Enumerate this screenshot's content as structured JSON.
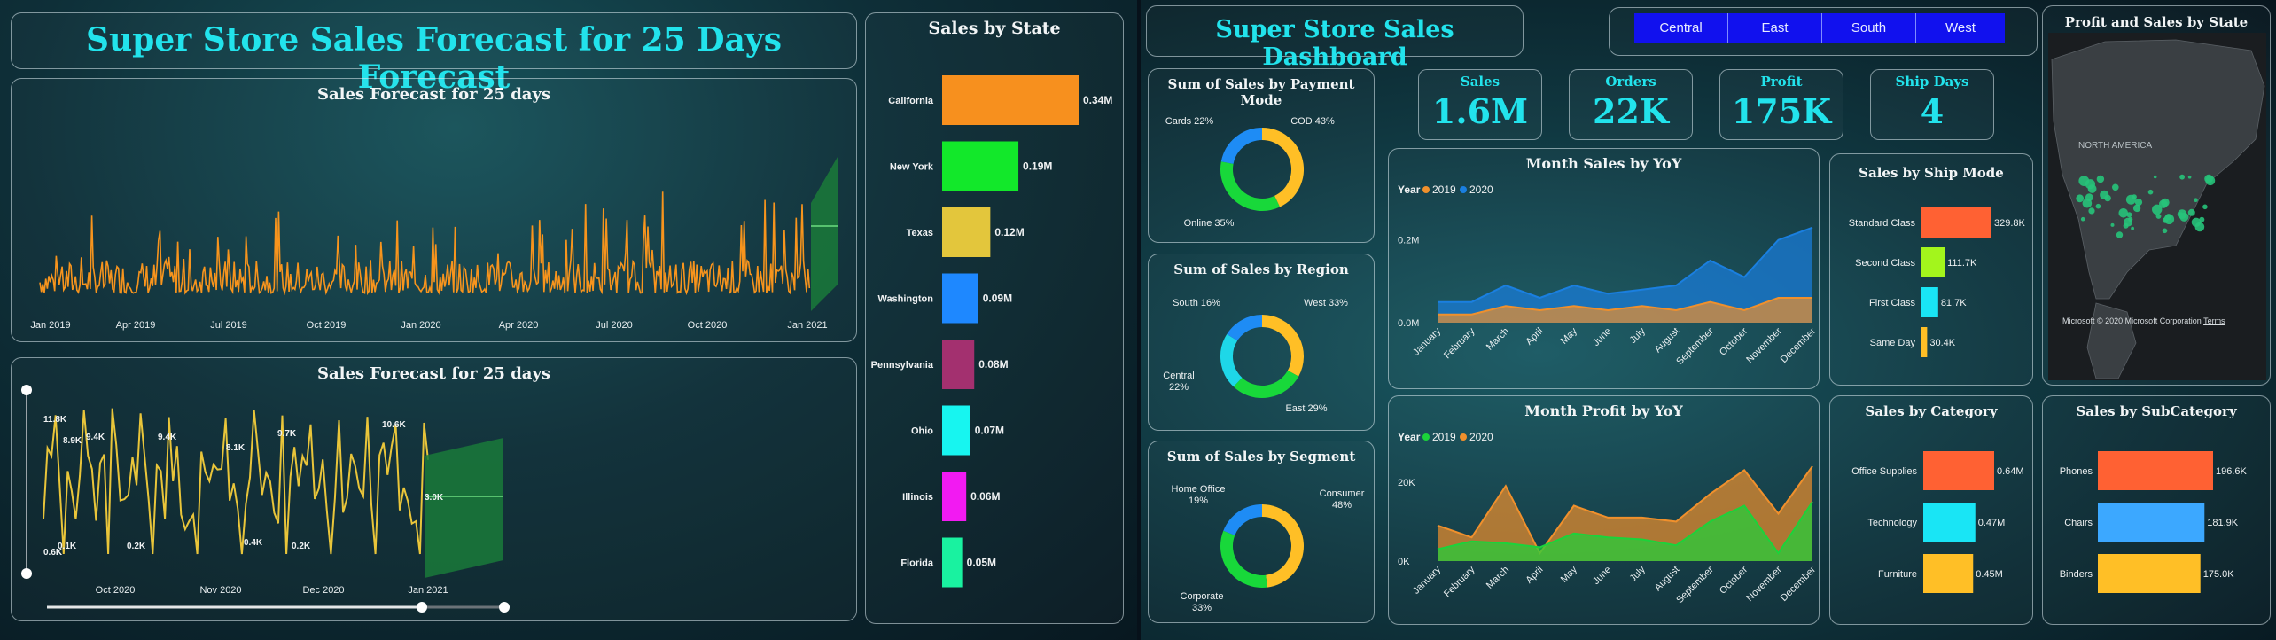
{
  "forecast": {
    "title": "Super Store Sales Forecast for 25 Days Forecast",
    "chart1": {
      "title": "Sales Forecast for 25 days",
      "x_ticks": [
        "Jan 2019",
        "Apr 2019",
        "Jul 2019",
        "Oct 2019",
        "Jan 2020",
        "Apr 2020",
        "Jul 2020",
        "Oct 2020",
        "Jan 2021"
      ]
    },
    "chart2": {
      "title": "Sales Forecast for 25 days",
      "x_ticks": [
        "Oct 2020",
        "Nov 2020",
        "Dec 2020",
        "Jan 2021"
      ],
      "peak_labels": [
        "11.8K",
        "8.9K",
        "9.4K",
        "9.4K",
        "8.1K",
        "9.7K",
        "10.6K",
        "3.0K"
      ],
      "low_labels": [
        "0.6K",
        "0.1K",
        "0.2K",
        "0.4K",
        "0.2K"
      ]
    },
    "state_chart": {
      "title": "Sales by State",
      "states": [
        "California",
        "New York",
        "Texas",
        "Washington",
        "Pennsylvania",
        "Ohio",
        "Illinois",
        "Florida"
      ],
      "values": [
        0.34,
        0.19,
        0.12,
        0.09,
        0.08,
        0.07,
        0.06,
        0.05
      ],
      "labels": [
        "0.34M",
        "0.19M",
        "0.12M",
        "0.09M",
        "0.08M",
        "0.07M",
        "0.06M",
        "0.05M"
      ],
      "colors": [
        "#f7901e",
        "#12e82a",
        "#e3c63c",
        "#1e88ff",
        "#a3306f",
        "#17f5f0",
        "#f21af2",
        "#19f2a0"
      ]
    }
  },
  "dashboard": {
    "title": "Super Store Sales Dashboard",
    "region_tabs": [
      "Central",
      "East",
      "South",
      "West"
    ],
    "kpis": [
      {
        "label": "Sales",
        "value": "1.6M"
      },
      {
        "label": "Orders",
        "value": "22K"
      },
      {
        "label": "Profit",
        "value": "175K"
      },
      {
        "label": "Ship Days",
        "value": "4"
      }
    ],
    "payment_chart": {
      "title": "Sum of Sales by Payment Mode",
      "slices": [
        {
          "name": "COD",
          "label": "COD 43%",
          "value": 43,
          "color": "#ffbf26"
        },
        {
          "name": "Online",
          "label": "Online 35%",
          "value": 35,
          "color": "#18d83a"
        },
        {
          "name": "Cards",
          "label": "Cards 22%",
          "value": 22,
          "color": "#1e8cf5"
        }
      ]
    },
    "region_chart": {
      "title": "Sum of Sales by Region",
      "slices": [
        {
          "name": "West",
          "label": "West 33%",
          "value": 33,
          "color": "#ffbf26"
        },
        {
          "name": "East",
          "label": "East 29%",
          "value": 29,
          "color": "#18d83a"
        },
        {
          "name": "Central",
          "label": "Central 22%",
          "value": 22,
          "color": "#1ed7e8"
        },
        {
          "name": "South",
          "label": "South 16%",
          "value": 16,
          "color": "#1e8cf5"
        }
      ]
    },
    "segment_chart": {
      "title": "Sum of Sales by Segment",
      "slices": [
        {
          "name": "Consumer",
          "label": "Consumer 48%",
          "value": 48,
          "color": "#ffbf26"
        },
        {
          "name": "Corporate",
          "label": "Corporate 33%",
          "value": 33,
          "color": "#18d83a"
        },
        {
          "name": "Home Office",
          "label": "Home Office 19%",
          "value": 19,
          "color": "#1e8cf5"
        }
      ]
    },
    "month_sales": {
      "title": "Month Sales by YoY",
      "legend_title": "Year",
      "months": [
        "January",
        "February",
        "March",
        "April",
        "May",
        "June",
        "July",
        "August",
        "September",
        "October",
        "November",
        "December"
      ],
      "y_ticks": [
        "0.0M",
        "0.2M"
      ],
      "series": [
        {
          "name": "2019",
          "color": "#f0902c",
          "values": [
            0.02,
            0.02,
            0.04,
            0.03,
            0.04,
            0.03,
            0.04,
            0.03,
            0.05,
            0.03,
            0.06,
            0.06
          ]
        },
        {
          "name": "2020",
          "color": "#1a7fe0",
          "values": [
            0.05,
            0.05,
            0.09,
            0.06,
            0.09,
            0.07,
            0.08,
            0.09,
            0.15,
            0.11,
            0.2,
            0.23
          ]
        }
      ]
    },
    "month_profit": {
      "title": "Month Profit by YoY",
      "legend_title": "Year",
      "months": [
        "January",
        "February",
        "March",
        "April",
        "May",
        "June",
        "July",
        "August",
        "September",
        "October",
        "November",
        "December"
      ],
      "y_ticks": [
        "0K",
        "20K"
      ],
      "series": [
        {
          "name": "2019",
          "color": "#1bd33a",
          "values": [
            3000,
            5000,
            4500,
            3500,
            7000,
            6000,
            5500,
            4000,
            10000,
            14000,
            2000,
            15000
          ]
        },
        {
          "name": "2020",
          "color": "#f0902c",
          "values": [
            9000,
            6000,
            19000,
            2000,
            14000,
            11000,
            11000,
            10000,
            17000,
            23000,
            12000,
            24000
          ]
        }
      ]
    },
    "ship_mode": {
      "title": "Sales by Ship Mode",
      "items": [
        "Standard Class",
        "Second Class",
        "First Class",
        "Same Day"
      ],
      "values": [
        329.8,
        111.7,
        81.7,
        30.4
      ],
      "labels": [
        "329.8K",
        "111.7K",
        "81.7K",
        "30.4K"
      ],
      "colors": [
        "#ff6133",
        "#a3f51c",
        "#19e5f5",
        "#ffbf26"
      ]
    },
    "category": {
      "title": "Sales by Category",
      "items": [
        "Office Supplies",
        "Technology",
        "Furniture"
      ],
      "values": [
        0.64,
        0.47,
        0.45
      ],
      "labels": [
        "0.64M",
        "0.47M",
        "0.45M"
      ],
      "colors": [
        "#ff6133",
        "#19e5f5",
        "#ffbf26"
      ]
    },
    "subcategory": {
      "title": "Sales by SubCategory",
      "items": [
        "Phones",
        "Chairs",
        "Binders"
      ],
      "values": [
        196.6,
        181.9,
        175.0
      ],
      "labels": [
        "196.6K",
        "181.9K",
        "175.0K"
      ],
      "colors": [
        "#ff6133",
        "#3ca8ff",
        "#ffbf26"
      ]
    },
    "map": {
      "title": "Profit and Sales by State",
      "region_label": "NORTH AMERICA",
      "attribution": "© 2020 Microsoft Corporation",
      "terms": "Terms",
      "brand": "Microsoft"
    }
  }
}
